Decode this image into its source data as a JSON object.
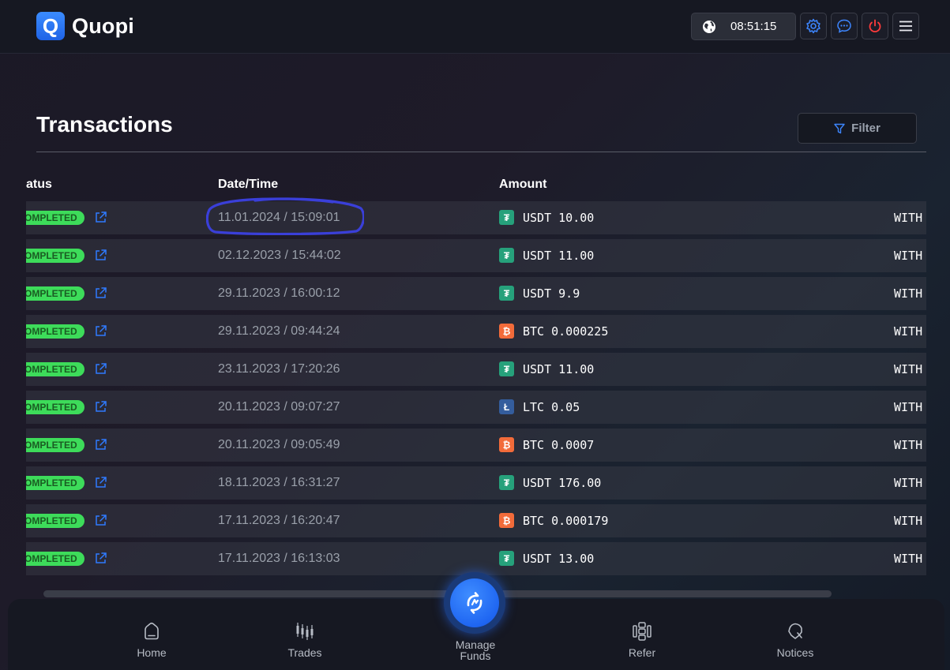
{
  "app": {
    "name": "Quopi",
    "logo_letter": "Q"
  },
  "header": {
    "time": "08:51:15",
    "buttons": [
      {
        "name": "settings",
        "icon": "gear-icon"
      },
      {
        "name": "chat",
        "icon": "chat-icon"
      },
      {
        "name": "power",
        "icon": "power-icon"
      },
      {
        "name": "menu",
        "icon": "hamburger-icon"
      }
    ]
  },
  "page": {
    "title": "Transactions",
    "filter_label": "Filter"
  },
  "table": {
    "columns": {
      "status": "atus",
      "datetime": "Date/Time",
      "amount": "Amount"
    },
    "rows": [
      {
        "status": "OMPLETED",
        "datetime": "11.01.2024 / 15:09:01",
        "coin": "USDT",
        "amount": "USDT 10.00",
        "type": "WITH"
      },
      {
        "status": "OMPLETED",
        "datetime": "02.12.2023 / 15:44:02",
        "coin": "USDT",
        "amount": "USDT 11.00",
        "type": "WITH"
      },
      {
        "status": "OMPLETED",
        "datetime": "29.11.2023 / 16:00:12",
        "coin": "USDT",
        "amount": "USDT 9.9",
        "type": "WITH"
      },
      {
        "status": "OMPLETED",
        "datetime": "29.11.2023 / 09:44:24",
        "coin": "BTC",
        "amount": "BTC 0.000225",
        "type": "WITH"
      },
      {
        "status": "OMPLETED",
        "datetime": "23.11.2023 / 17:20:26",
        "coin": "USDT",
        "amount": "USDT 11.00",
        "type": "WITH"
      },
      {
        "status": "OMPLETED",
        "datetime": "20.11.2023 / 09:07:27",
        "coin": "LTC",
        "amount": "LTC 0.05",
        "type": "WITH"
      },
      {
        "status": "OMPLETED",
        "datetime": "20.11.2023 / 09:05:49",
        "coin": "BTC",
        "amount": "BTC 0.0007",
        "type": "WITH"
      },
      {
        "status": "OMPLETED",
        "datetime": "18.11.2023 / 16:31:27",
        "coin": "USDT",
        "amount": "USDT 176.00",
        "type": "WITH"
      },
      {
        "status": "OMPLETED",
        "datetime": "17.11.2023 / 16:20:47",
        "coin": "BTC",
        "amount": "BTC 0.000179",
        "type": "WITH"
      },
      {
        "status": "OMPLETED",
        "datetime": "17.11.2023 / 16:13:03",
        "coin": "USDT",
        "amount": "USDT 13.00",
        "type": "WITH"
      }
    ]
  },
  "coins": {
    "USDT": {
      "glyph": "₮",
      "color": "#26a17b"
    },
    "BTC": {
      "glyph": "₿",
      "color": "#f26b3a"
    },
    "LTC": {
      "glyph": "Ł",
      "color": "#345d9d"
    }
  },
  "colors": {
    "accent": "#2f7bff",
    "status_green": "#3ddc5a",
    "annotation": "#3a3fd9"
  },
  "nav": {
    "items": [
      {
        "label": "Home",
        "icon": "home-icon"
      },
      {
        "label": "Trades",
        "icon": "candles-icon"
      },
      {
        "label": "Refer",
        "icon": "refer-icon"
      },
      {
        "label": "Notices",
        "icon": "bell-icon"
      }
    ],
    "fab_label": "Manage\nFunds"
  }
}
